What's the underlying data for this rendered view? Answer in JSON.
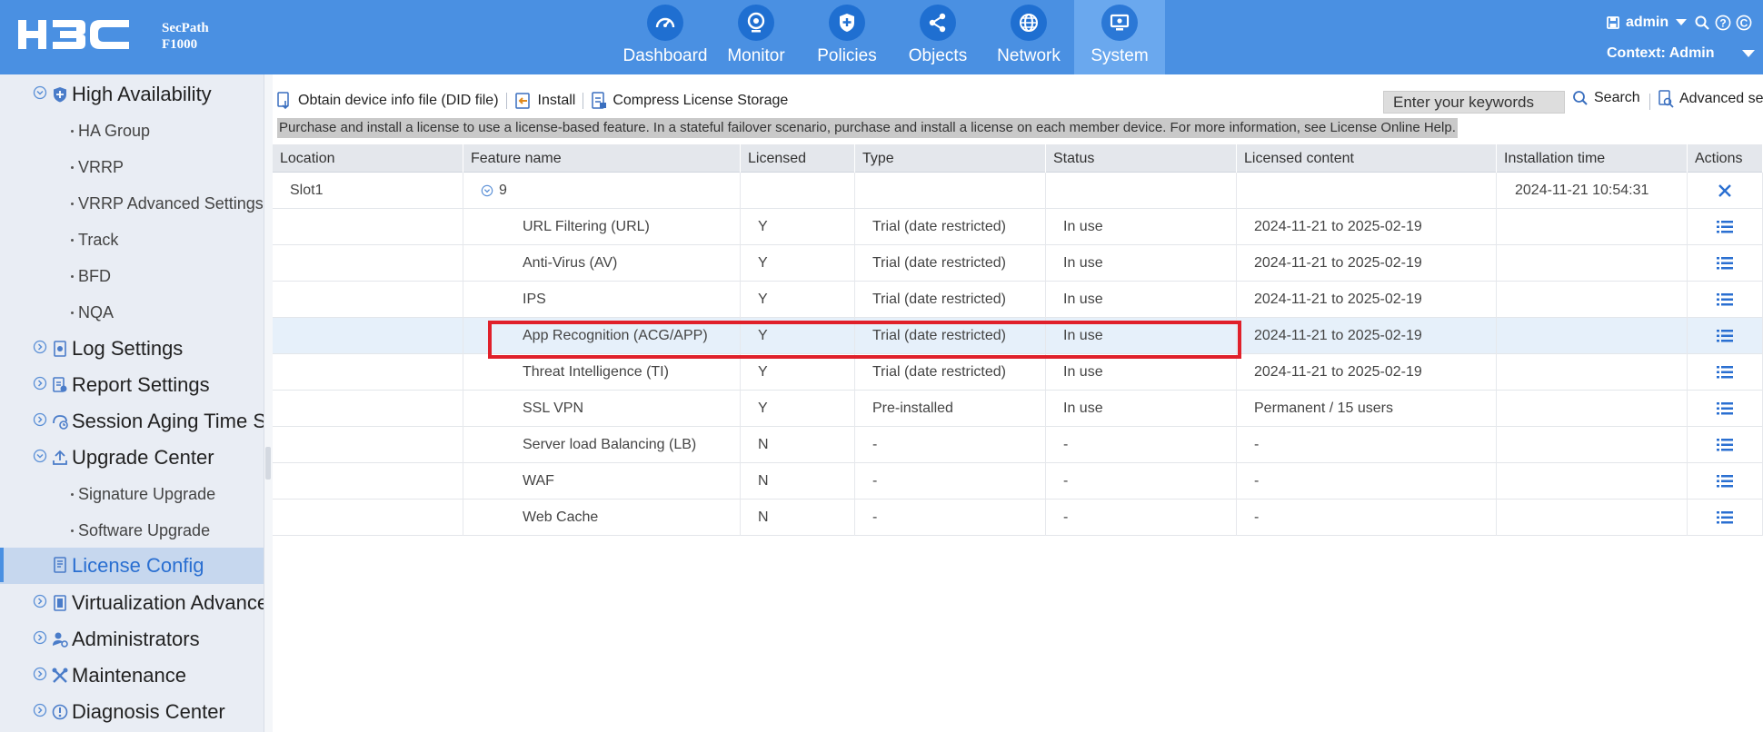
{
  "brand": {
    "logo_text": "H3C",
    "product_line1": "SecPath",
    "product_line2": "F1000"
  },
  "nav": [
    {
      "label": "Dashboard",
      "icon": "speedometer-icon",
      "active": false
    },
    {
      "label": "Monitor",
      "icon": "monitor-eye-icon",
      "active": false
    },
    {
      "label": "Policies",
      "icon": "shield-plus-icon",
      "active": false
    },
    {
      "label": "Objects",
      "icon": "share-nodes-icon",
      "active": false
    },
    {
      "label": "Network",
      "icon": "globe-icon",
      "active": false
    },
    {
      "label": "System",
      "icon": "system-monitor-icon",
      "active": true
    }
  ],
  "user": {
    "name": "admin",
    "context": "Context: Admin"
  },
  "sidebar": {
    "ha": "High Availability",
    "ha_group": "HA Group",
    "vrrp": "VRRP",
    "vrrp_adv": "VRRP Advanced Settings",
    "track": "Track",
    "bfd": "BFD",
    "nqa": "NQA",
    "log": "Log Settings",
    "report": "Report Settings",
    "session": "Session Aging Time Se",
    "upgrade": "Upgrade Center",
    "sig_upgrade": "Signature Upgrade",
    "sw_upgrade": "Software Upgrade",
    "license": "License Config",
    "virt": "Virtualization Advance",
    "admins": "Administrators",
    "maint": "Maintenance",
    "diag": "Diagnosis Center"
  },
  "toolbar": {
    "did": "Obtain device info file (DID file)",
    "install": "Install",
    "compress": "Compress License Storage",
    "search_value": "Enter your keywords",
    "search": "Search",
    "advanced": "Advanced se"
  },
  "notice": "Purchase and install a license to use a license-based feature. In a stateful failover scenario, purchase and install a license on each member device. For more information, see License Online Help.",
  "table": {
    "columns": [
      "Location",
      "Feature name",
      "Licensed",
      "Type",
      "Status",
      "Licensed content",
      "Installation time",
      "Actions"
    ],
    "group": {
      "location": "Slot1",
      "count": "9",
      "installation_time": "2024-11-21 10:54:31"
    },
    "rows": [
      {
        "feature": "URL Filtering (URL)",
        "licensed": "Y",
        "type": "Trial (date restricted)",
        "status": "In use",
        "content": "2024-11-21 to 2025-02-19"
      },
      {
        "feature": "Anti-Virus (AV)",
        "licensed": "Y",
        "type": "Trial (date restricted)",
        "status": "In use",
        "content": "2024-11-21 to 2025-02-19"
      },
      {
        "feature": "IPS",
        "licensed": "Y",
        "type": "Trial (date restricted)",
        "status": "In use",
        "content": "2024-11-21 to 2025-02-19"
      },
      {
        "feature": "App Recognition (ACG/APP)",
        "licensed": "Y",
        "type": "Trial (date restricted)",
        "status": "In use",
        "content": "2024-11-21 to 2025-02-19"
      },
      {
        "feature": "Threat Intelligence (TI)",
        "licensed": "Y",
        "type": "Trial (date restricted)",
        "status": "In use",
        "content": "2024-11-21 to 2025-02-19"
      },
      {
        "feature": "SSL VPN",
        "licensed": "Y",
        "type": "Pre-installed",
        "status": "In use",
        "content": "Permanent / 15 users"
      },
      {
        "feature": "Server load Balancing (LB)",
        "licensed": "N",
        "type": "-",
        "status": "-",
        "content": "-"
      },
      {
        "feature": "WAF",
        "licensed": "N",
        "type": "-",
        "status": "-",
        "content": "-"
      },
      {
        "feature": "Web Cache",
        "licensed": "N",
        "type": "-",
        "status": "-",
        "content": "-"
      }
    ]
  },
  "colors": {
    "header": "#4a90e2",
    "nav_icon": "#1f6fd1",
    "sidebar": "#e9edf4",
    "highlight_box": "#e0202a",
    "action_blue": "#2a6fd1"
  }
}
